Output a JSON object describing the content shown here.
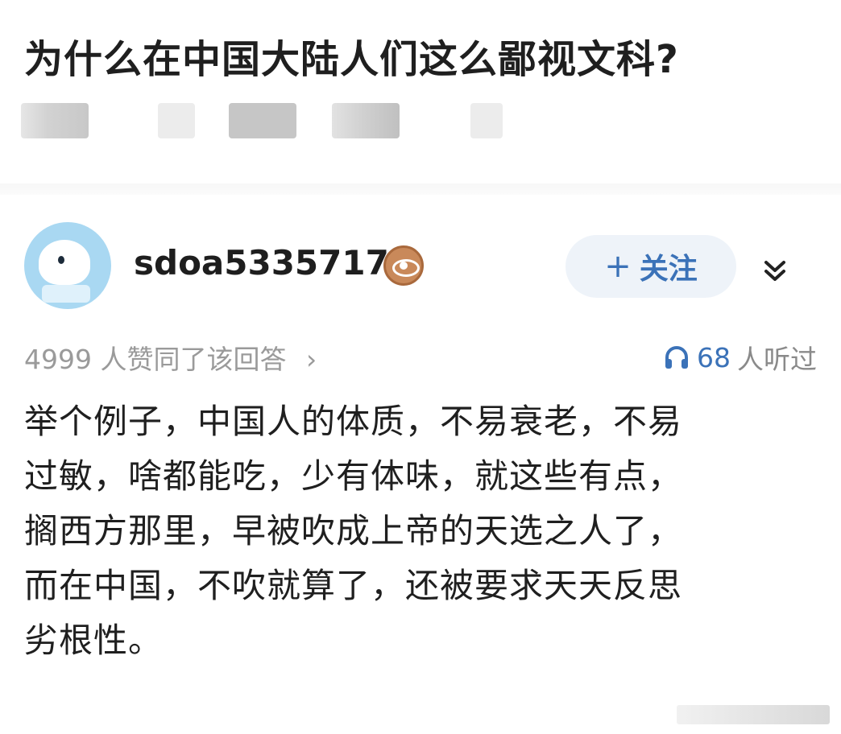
{
  "question": {
    "title": "为什么在中国大陆人们这么鄙视文科?"
  },
  "author": {
    "username": "sdoa5335717",
    "follow_label": "关注",
    "follow_plus": "+"
  },
  "stats": {
    "likes_text": "4999 人赞同了该回答",
    "likes_chevron": "›",
    "listen_count": "68",
    "listen_suffix": "人听过"
  },
  "answer": {
    "lines": [
      "举个例子，中国人的体质，不易衰老，不易",
      "过敏，啥都能吃，少有体味，就这些有点，",
      "搁西方那里，早被吹成上帝的天选之人了，",
      "而在中国，不吹就算了，还被要求天天反思",
      "劣根性。"
    ]
  },
  "colors": {
    "accent": "#3b72b8",
    "muted": "#9a9a9a"
  }
}
